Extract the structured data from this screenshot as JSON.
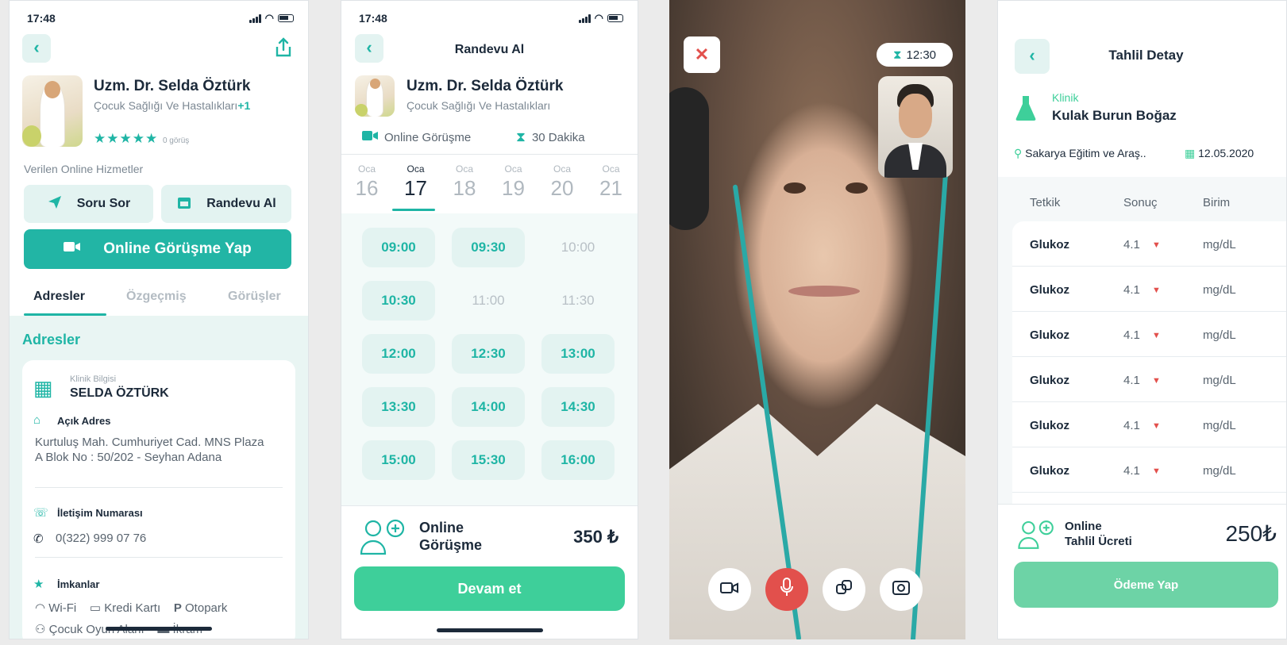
{
  "status": {
    "time": "17:48"
  },
  "screen1": {
    "doctor_name": "Uzm. Dr. Selda Öztürk",
    "specialty": "Çocuk Sağlığı Ve Hastalıkları",
    "specialty_extra": "+1",
    "stars": "★★★★★",
    "rating_count": 5,
    "review_count": "0 görüş",
    "services_label": "Verilen Online Hizmetler",
    "ask_button": "Soru Sor",
    "appointment_button": "Randevu Al",
    "online_button": "Online Görüşme Yap",
    "tabs": [
      "Adresler",
      "Özgeçmiş",
      "Görüşler"
    ],
    "section_title": "Adresler",
    "clinic_label": "Klinik Bilgisi",
    "clinic_name": "SELDA ÖZTÜRK",
    "address_label": "Açık Adres",
    "address": "Kurtuluş Mah. Cumhuriyet Cad. MNS Plaza A Blok No : 50/202  -  Seyhan Adana",
    "phone_label": "İletişim Numarası",
    "phone": "0(322) 999 07 76",
    "facilities_label": "İmkanlar",
    "facilities": [
      "Wi-Fi",
      "Kredi Kartı",
      "Otopark",
      "Çocuk Oyun Alanı",
      "İkram"
    ]
  },
  "screen2": {
    "title": "Randevu Al",
    "doctor_name": "Uzm. Dr. Selda Öztürk",
    "specialty": "Çocuk Sağlığı Ve Hastalıkları",
    "meeting_type": "Online Görüşme",
    "duration": "30 Dakika",
    "dates": [
      {
        "month": "Oca",
        "day": "16"
      },
      {
        "month": "Oca",
        "day": "17"
      },
      {
        "month": "Oca",
        "day": "18"
      },
      {
        "month": "Oca",
        "day": "19"
      },
      {
        "month": "Oca",
        "day": "20"
      },
      {
        "month": "Oca",
        "day": "21"
      }
    ],
    "selected_date_index": 1,
    "slots": [
      {
        "time": "09:00",
        "available": true
      },
      {
        "time": "09:30",
        "available": true
      },
      {
        "time": "10:00",
        "available": false
      },
      {
        "time": "10:30",
        "available": true
      },
      {
        "time": "11:00",
        "available": false
      },
      {
        "time": "11:30",
        "available": false
      },
      {
        "time": "12:00",
        "available": true
      },
      {
        "time": "12:30",
        "available": true
      },
      {
        "time": "13:00",
        "available": true
      },
      {
        "time": "13:30",
        "available": true
      },
      {
        "time": "14:00",
        "available": true
      },
      {
        "time": "14:30",
        "available": true
      },
      {
        "time": "15:00",
        "available": true
      },
      {
        "time": "15:30",
        "available": true
      },
      {
        "time": "16:00",
        "available": true
      }
    ],
    "summary_line1": "Online",
    "summary_line2": "Görüşme",
    "price": "350 ₺",
    "continue_button": "Devam et"
  },
  "screen3": {
    "timer": "12:30"
  },
  "screen4": {
    "title": "Tahlil Detay",
    "clinic_label": "Klinik",
    "clinic_name": "Kulak Burun Boğaz",
    "hospital": "Sakarya Eğitim ve Araş..",
    "date": "12.05.2020",
    "headers": [
      "Tetkik",
      "Sonuç",
      "Birim"
    ],
    "rows": [
      {
        "test": "Glukoz",
        "result": "4.1",
        "unit": "mg/dL"
      },
      {
        "test": "Glukoz",
        "result": "4.1",
        "unit": "mg/dL"
      },
      {
        "test": "Glukoz",
        "result": "4.1",
        "unit": "mg/dL"
      },
      {
        "test": "Glukoz",
        "result": "4.1",
        "unit": "mg/dL"
      },
      {
        "test": "Glukoz",
        "result": "4.1",
        "unit": "mg/dL"
      },
      {
        "test": "Glukoz",
        "result": "4.1",
        "unit": "mg/dL"
      }
    ],
    "fee_line1": "Online",
    "fee_line2": "Tahlil Ücreti",
    "price": "250₺",
    "pay_button": "Ödeme Yap"
  },
  "colors": {
    "accent": "#1fb5a5",
    "accent_light": "#e3f3f1",
    "green_button": "#3ecf9a",
    "danger": "#e2504c",
    "text": "#1c2a3a"
  }
}
